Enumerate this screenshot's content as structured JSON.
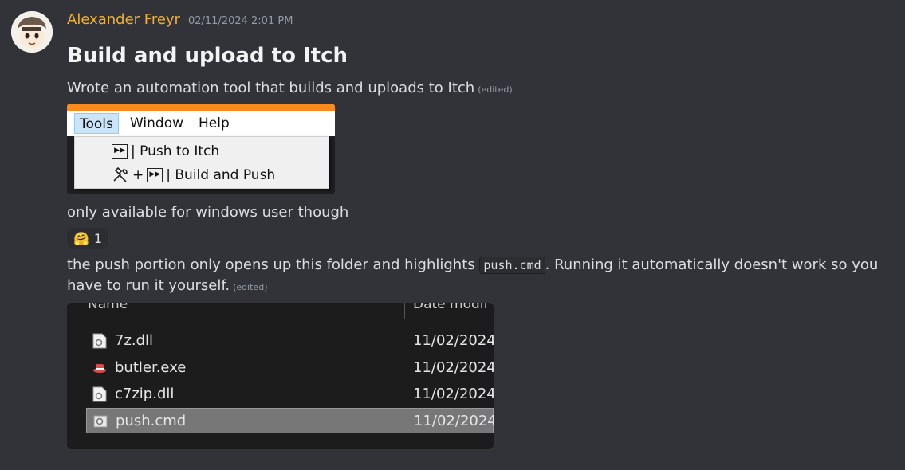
{
  "author": {
    "name": "Alexander Freyr",
    "timestamp": "02/11/2024 2:01 PM",
    "name_color": "#f0b232"
  },
  "message": {
    "heading": "Build and upload to Itch",
    "para1": "Wrote an automation tool that builds and uploads to Itch",
    "edited_label": "(edited)",
    "para2": "only available for windows user though",
    "para3_before": "the push portion only opens up this folder and highlights",
    "para3_code": "push.cmd",
    "para3_after": ". Running it automatically doesn't work so you have to run it yourself."
  },
  "reaction": {
    "emoji": "🤗",
    "count": "1"
  },
  "menu_image": {
    "menubar": [
      "Tools",
      "Window",
      "Help"
    ],
    "active_menu": "Tools",
    "items": [
      {
        "icon": "fast-forward-icon",
        "label": "| Push to Itch"
      },
      {
        "icon": "hammer-wrench-icon",
        "plus": "+",
        "label": "| Build and Push"
      }
    ],
    "accent": "#fa8a1e"
  },
  "explorer_image": {
    "columns": [
      "Name",
      "Date modif"
    ],
    "files": [
      {
        "name": "7z.dll",
        "date": "11/02/2024",
        "icon": "dll-file-icon",
        "selected": false
      },
      {
        "name": "butler.exe",
        "date": "11/02/2024",
        "icon": "butler-exe-icon",
        "selected": false
      },
      {
        "name": "c7zip.dll",
        "date": "11/02/2024",
        "icon": "dll-file-icon",
        "selected": false
      },
      {
        "name": "push.cmd",
        "date": "11/02/2024",
        "icon": "cmd-file-icon",
        "selected": true
      }
    ]
  }
}
